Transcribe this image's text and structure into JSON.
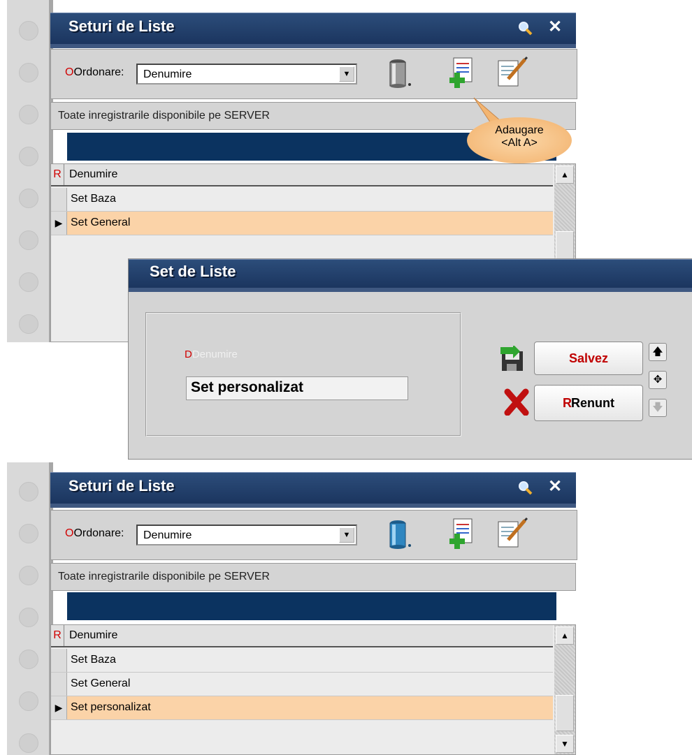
{
  "window1": {
    "title": "Seturi de Liste",
    "order_label": "Ordonare:",
    "order_value": "Denumire",
    "server_label": "Toate inregistrarile disponibile pe SERVER",
    "col_r": "R",
    "col_header": "Denumire",
    "rows": [
      "Set Baza",
      "Set General"
    ],
    "selected_row": "Set General"
  },
  "tooltip": {
    "line1": "Adaugare",
    "line2": "<Alt A>"
  },
  "dialog": {
    "title": "Set de Liste",
    "field_label": "Denumire",
    "field_value": "Set personalizat",
    "save_label": "Salvez",
    "cancel_label": "Renunt"
  },
  "window2": {
    "title": "Seturi de Liste",
    "order_label": "Ordonare:",
    "order_value": "Denumire",
    "server_label": "Toate inregistrarile disponibile pe SERVER",
    "col_r": "R",
    "col_header": "Denumire",
    "rows": [
      "Set Baza",
      "Set General",
      "Set personalizat"
    ],
    "selected_row": "Set personalizat"
  },
  "colors": {
    "title_bar": "#1b355f",
    "navy_bar": "#0b3360",
    "selected_row": "#fbd3a8",
    "accent_red": "#d00000"
  },
  "icons": [
    "search-icon",
    "close-icon",
    "trash-icon",
    "add-document-icon",
    "edit-document-icon",
    "save-icon",
    "cancel-x-icon",
    "arrow-up-icon",
    "move-icon",
    "arrow-down-icon"
  ]
}
